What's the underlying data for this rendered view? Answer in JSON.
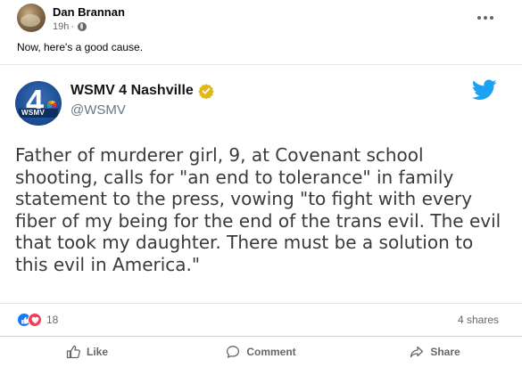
{
  "post": {
    "author": "Dan Brannan",
    "time": "19h",
    "separator": "·",
    "text": "Now, here's a good cause.",
    "icons": {
      "audience": "globe-icon",
      "menu": "more-options-icon"
    }
  },
  "embed": {
    "logo": {
      "numeral": "4",
      "band_label": "WSMV"
    },
    "account_name": "WSMV 4 Nashville",
    "handle": "@WSMV",
    "tweet_text": "Father of murderer girl, 9, at Covenant school shooting, calls for \"an end to tolerance\" in family statement to the press, vowing \"to fight with every fiber of my being for the end of the trans evil. The evil that took my daughter. There must be a solution to this evil in America.\"",
    "colors": {
      "twitter_blue": "#1da1f2",
      "verified_gold": "#e2b719",
      "text": "#3a3a3a"
    },
    "icons": {
      "verified": "verified-badge-icon",
      "platform": "twitter-bird-icon"
    }
  },
  "stats": {
    "reaction_count": "18",
    "shares": "4 shares",
    "reactions": [
      "like",
      "love"
    ]
  },
  "actions": [
    {
      "label": "Like",
      "icon": "thumbs-up-icon"
    },
    {
      "label": "Comment",
      "icon": "comment-icon"
    },
    {
      "label": "Share",
      "icon": "share-icon"
    }
  ]
}
